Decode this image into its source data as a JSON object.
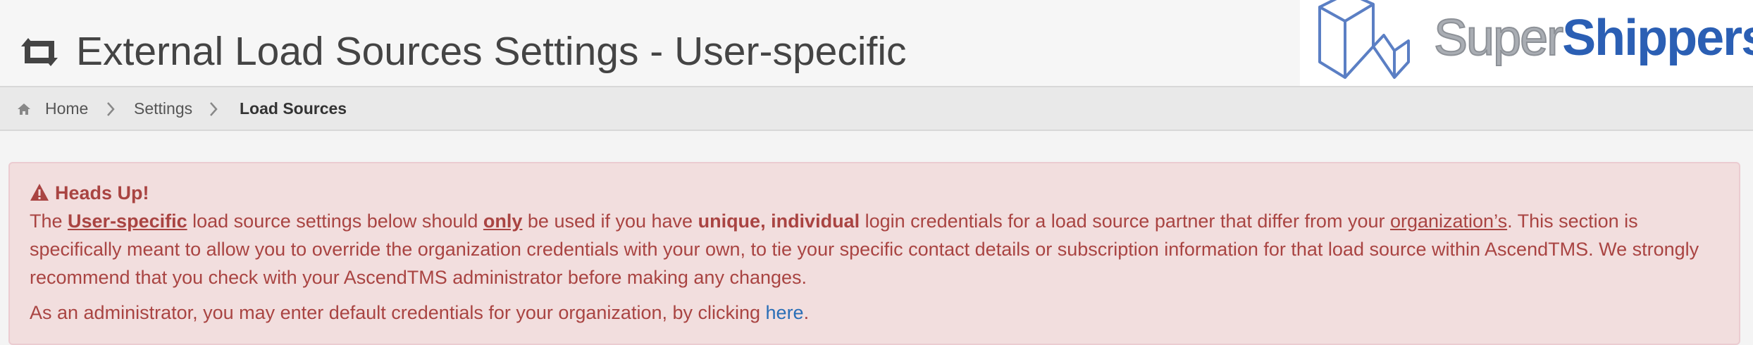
{
  "header": {
    "title": "External Load Sources Settings - User-specific",
    "title_icon": "retweet-icon"
  },
  "logo": {
    "part1": "Super",
    "part2": "Shippers",
    "colors": {
      "part1": "#a9adb3",
      "part2": "#2b5fb4"
    }
  },
  "breadcrumb": {
    "items": [
      {
        "label": "Home",
        "icon": "home-icon"
      },
      {
        "label": "Settings"
      },
      {
        "label": "Load Sources"
      }
    ]
  },
  "alert": {
    "heading": "Heads Up!",
    "p1": {
      "t1": "The ",
      "t2": "User-specific",
      "t3": " load source settings below should ",
      "t4": "only",
      "t5": " be used if you have ",
      "t6": "unique, individual",
      "t7": " login credentials for a load source partner that differ from your ",
      "t8": "organization’s",
      "t9": ". This section is specifically meant to allow you to override the organization credentials with your own, to tie your specific contact details or subscription information for that load source within AscendTMS. We strongly recommend that you check with your AscendTMS administrator before making any changes."
    },
    "p2": {
      "t1": "As an administrator, you may enter default credentials for your organization, by clicking ",
      "link": "here",
      "t2": "."
    },
    "colors": {
      "text": "#a94442",
      "background": "#f2dede",
      "link": "#2a6eb7"
    }
  }
}
